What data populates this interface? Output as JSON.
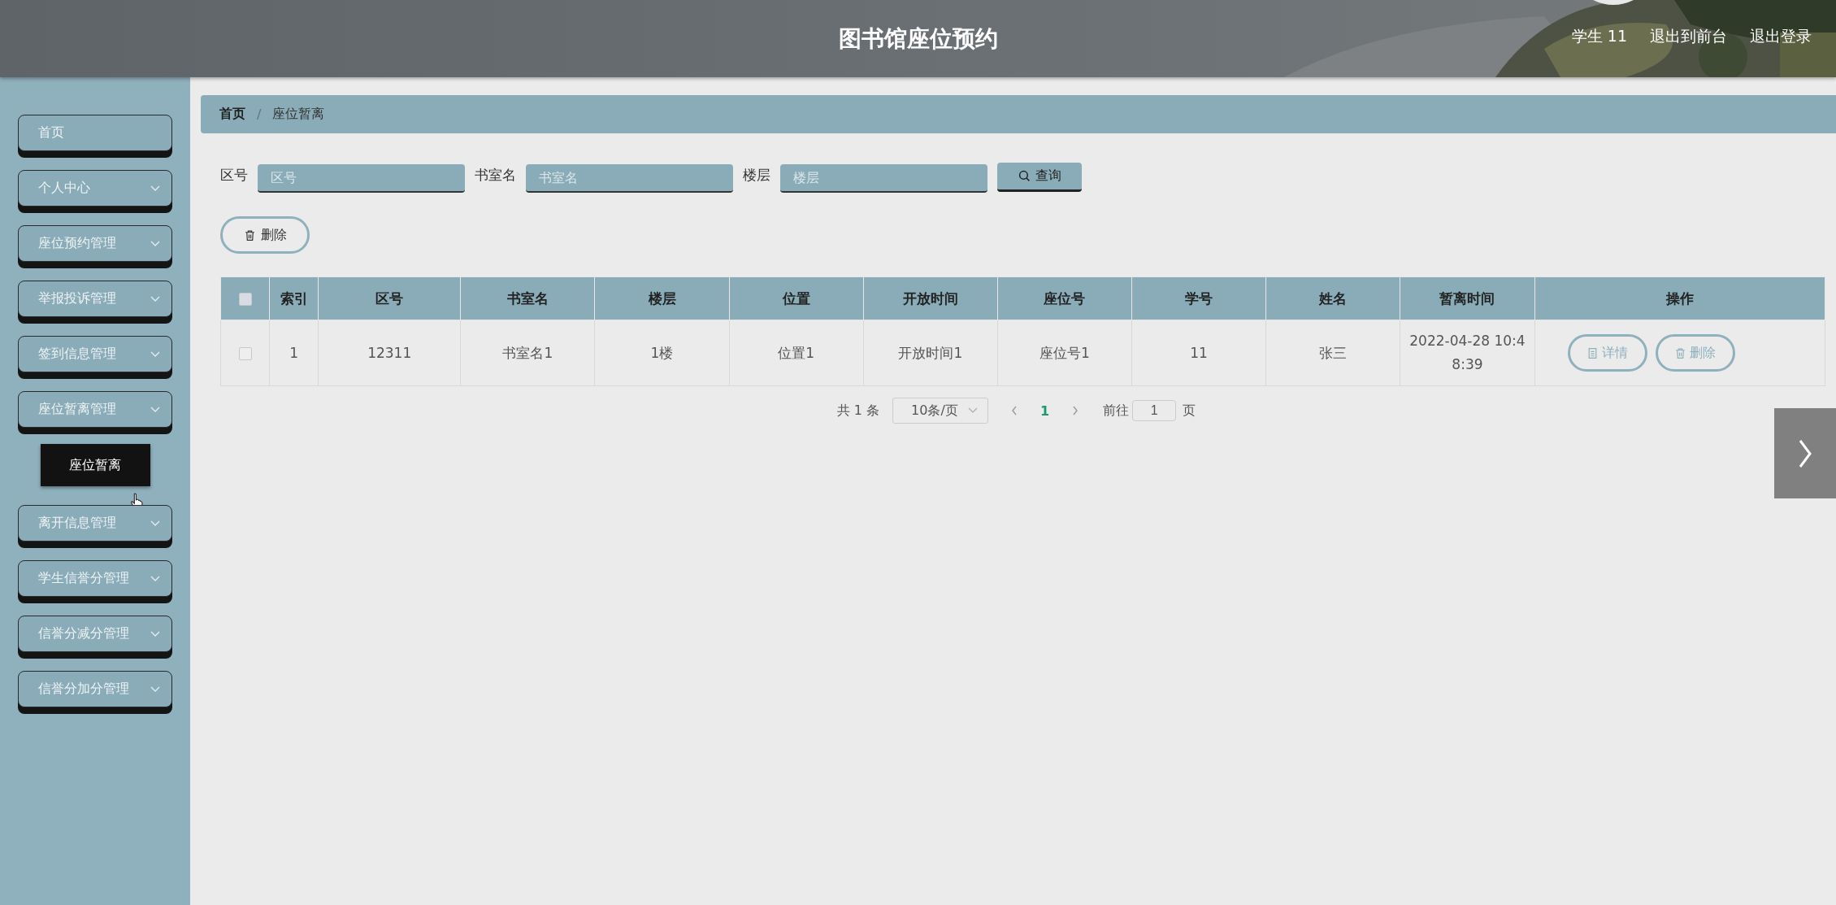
{
  "header": {
    "title": "图书馆座位预约",
    "links": [
      "学生 11",
      "退出到前台",
      "退出登录"
    ]
  },
  "sidebar": {
    "items": [
      {
        "label": "首页",
        "kind": "link"
      },
      {
        "label": "个人中心",
        "kind": "menu"
      },
      {
        "label": "座位预约管理",
        "kind": "menu"
      },
      {
        "label": "举报投诉管理",
        "kind": "menu"
      },
      {
        "label": "签到信息管理",
        "kind": "menu"
      },
      {
        "label": "座位暂离管理",
        "kind": "menu",
        "children": [
          {
            "label": "座位暂离"
          }
        ]
      },
      {
        "label": "离开信息管理",
        "kind": "menu"
      },
      {
        "label": "学生信誉分管理",
        "kind": "menu"
      },
      {
        "label": "信誉分减分管理",
        "kind": "menu"
      },
      {
        "label": "信誉分加分管理",
        "kind": "menu"
      }
    ]
  },
  "breadcrumb": {
    "items": [
      "首页",
      "座位暂离"
    ],
    "separator": "/"
  },
  "search": {
    "fields": [
      {
        "label": "区号",
        "placeholder": "区号"
      },
      {
        "label": "书室名",
        "placeholder": "书室名"
      },
      {
        "label": "楼层",
        "placeholder": "楼层"
      }
    ],
    "button": "查询"
  },
  "delete_button": "删除",
  "table": {
    "all_checked": false,
    "columns": [
      "索引",
      "区号",
      "书室名",
      "楼层",
      "位置",
      "开放时间",
      "座位号",
      "学号",
      "姓名",
      "暂离时间",
      "操作"
    ],
    "rows": [
      {
        "checked": false,
        "cells": [
          "1",
          "12311",
          "书室名1",
          "1楼",
          "位置1",
          "开放时间1",
          "座位号1",
          "11",
          "张三",
          "2022-04-28 10:48:39"
        ],
        "actions": [
          "详情",
          "删除"
        ]
      }
    ]
  },
  "pagination": {
    "total": "共 1 条",
    "page_size": "10条/页",
    "pages": [
      {
        "label": "1",
        "selected": true
      }
    ],
    "goto_label": "前往",
    "goto_value": "1",
    "goto_suffix": "页"
  }
}
